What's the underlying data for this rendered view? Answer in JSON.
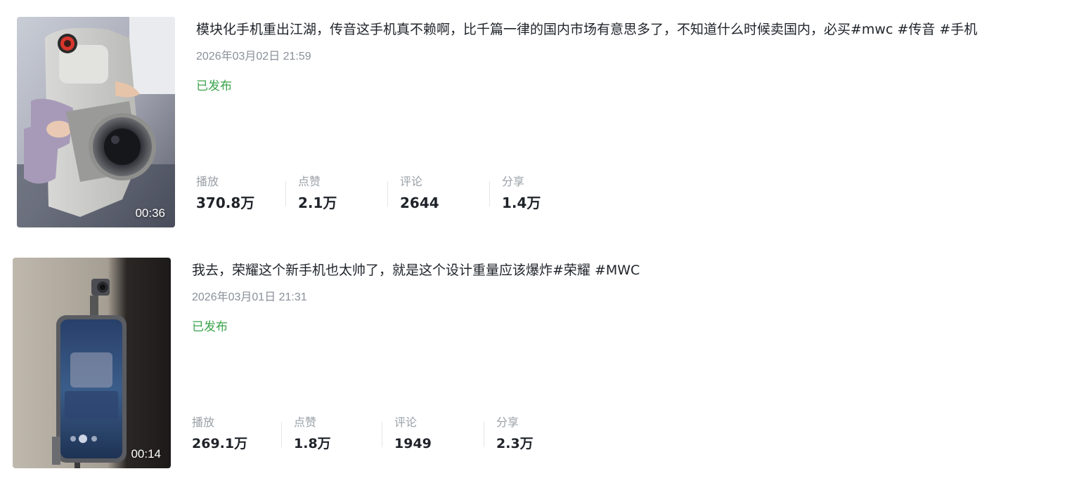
{
  "videos": [
    {
      "title": "模块化手机重出江湖，传音这手机真不赖啊，比千篇一律的国内市场有意思多了，不知道什么时候卖国内，必买#mwc #传音 #手机",
      "date": "2026年03月02日 21:59",
      "status": "已发布",
      "duration": "00:36",
      "thumbnail_icon": "video-thumbnail-camera-phone",
      "stats": [
        {
          "label": "播放",
          "value": "370.8万"
        },
        {
          "label": "点赞",
          "value": "2.1万"
        },
        {
          "label": "评论",
          "value": "2644"
        },
        {
          "label": "分享",
          "value": "1.4万"
        }
      ]
    },
    {
      "title": "我去，荣耀这个新手机也太帅了，就是这个设计重量应该爆炸#荣耀 #MWC",
      "date": "2026年03月01日 21:31",
      "status": "已发布",
      "duration": "00:14",
      "thumbnail_icon": "video-thumbnail-gimbal-phone",
      "stats": [
        {
          "label": "播放",
          "value": "269.1万"
        },
        {
          "label": "点赞",
          "value": "1.8万"
        },
        {
          "label": "评论",
          "value": "1949"
        },
        {
          "label": "分享",
          "value": "2.3万"
        }
      ]
    }
  ],
  "colors": {
    "status_green": "#3aa34a",
    "date_gray": "#8a8f99",
    "label_gray": "#9aa0a6",
    "text_dark": "#1f2329"
  }
}
